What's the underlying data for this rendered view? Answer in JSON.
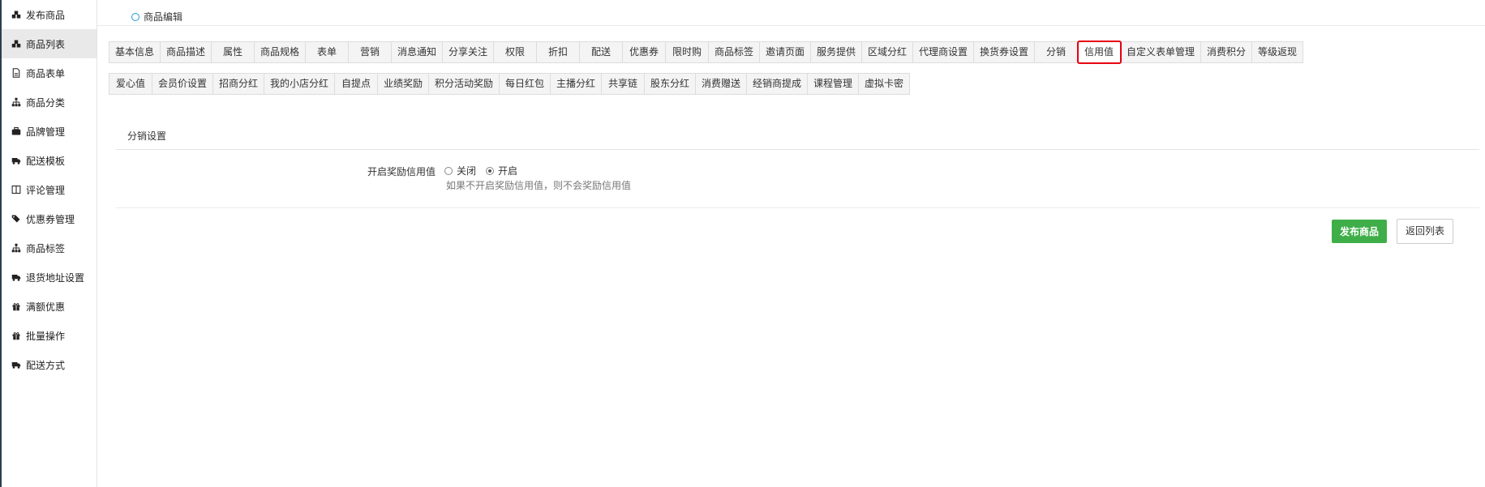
{
  "sidebar": {
    "items": [
      {
        "label": "发布商品",
        "icon": "cubes-icon"
      },
      {
        "label": "商品列表",
        "icon": "cubes-icon"
      },
      {
        "label": "商品表单",
        "icon": "file-icon"
      },
      {
        "label": "商品分类",
        "icon": "sitemap-icon"
      },
      {
        "label": "品牌管理",
        "icon": "briefcase-icon"
      },
      {
        "label": "配送模板",
        "icon": "truck-icon"
      },
      {
        "label": "评论管理",
        "icon": "columns-icon"
      },
      {
        "label": "优惠券管理",
        "icon": "tags-icon"
      },
      {
        "label": "商品标签",
        "icon": "sitemap-icon"
      },
      {
        "label": "退货地址设置",
        "icon": "truck-icon"
      },
      {
        "label": "满额优惠",
        "icon": "gift-icon"
      },
      {
        "label": "批量操作",
        "icon": "gift-icon"
      },
      {
        "label": "配送方式",
        "icon": "truck-icon"
      }
    ],
    "active_index": 1
  },
  "header": {
    "breadcrumb": "商品编辑"
  },
  "tabs": {
    "row1": [
      "基本信息",
      "商品描述",
      "属性",
      "商品规格",
      "表单",
      "营销",
      "消息通知",
      "分享关注",
      "权限",
      "折扣",
      "配送",
      "优惠券",
      "限时购",
      "商品标签",
      "邀请页面",
      "服务提供",
      "区域分红",
      "代理商设置",
      "换货券设置",
      "分销",
      "信用值",
      "自定义表单管理",
      "消费积分",
      "等级返现"
    ],
    "row2": [
      "爱心值",
      "会员价设置",
      "招商分红",
      "我的小店分红",
      "自提点",
      "业绩奖励",
      "积分活动奖励",
      "每日红包",
      "主播分红",
      "共享链",
      "股东分红",
      "消费赠送",
      "经销商提成",
      "课程管理",
      "虚拟卡密"
    ],
    "active": "信用值"
  },
  "section": {
    "title": "分销设置"
  },
  "form": {
    "label": "开启奖励信用值",
    "options": [
      "关闭",
      "开启"
    ],
    "selected": "开启",
    "hint": "如果不开启奖励信用值，则不会奖励信用值"
  },
  "buttons": {
    "publish": "发布商品",
    "back": "返回列表"
  },
  "colors": {
    "primary": "#3fae49",
    "highlight": "#e60012",
    "accent": "#1f9ad6"
  }
}
